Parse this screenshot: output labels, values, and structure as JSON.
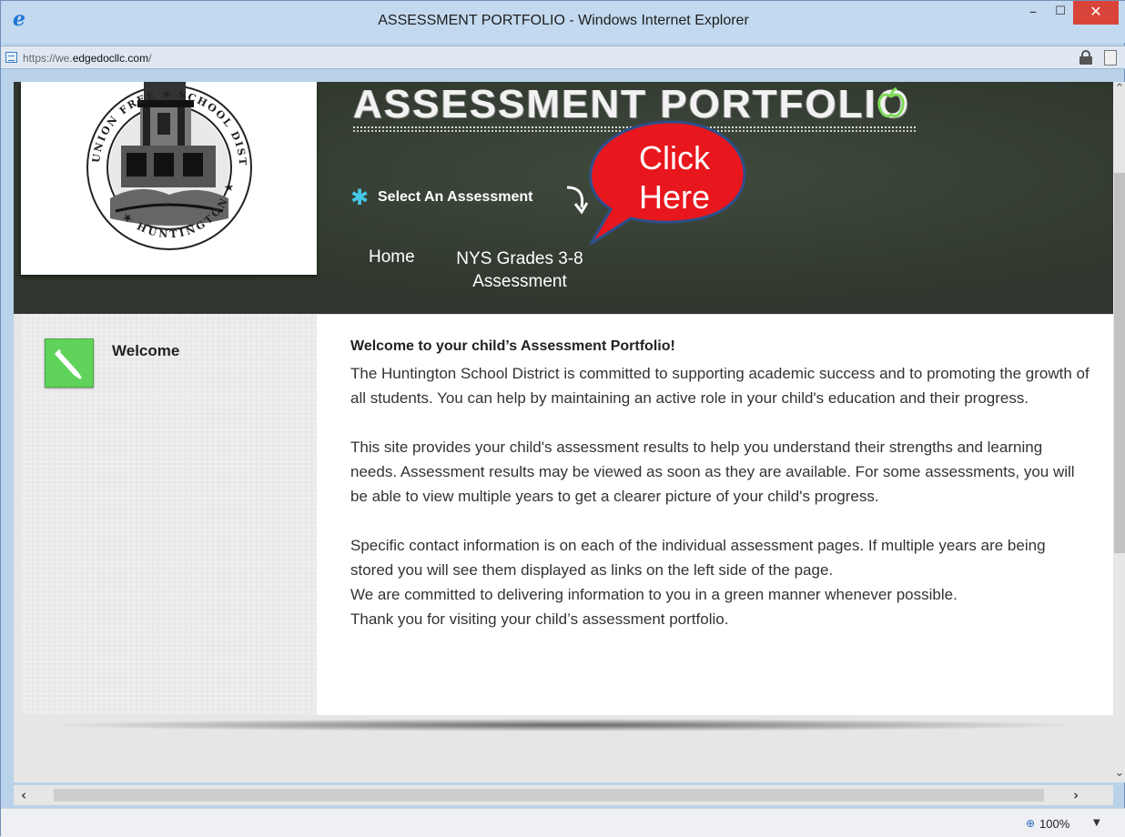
{
  "window": {
    "title": "ASSESSMENT PORTFOLIO - Windows Internet Explorer",
    "minimize_glyph": "–",
    "maximize_glyph": "☐",
    "close_glyph": "✕"
  },
  "address": {
    "url_prefix": "https://we.",
    "url_domain": "edgedocllc.com",
    "url_suffix": "/"
  },
  "header": {
    "title": "ASSESSMENT PORTFOLIO",
    "select_label": "Select An Assessment",
    "gear_glyph": "✱"
  },
  "nav": {
    "home": "Home",
    "nys_line1": "NYS Grades 3-8",
    "nys_line2": "Assessment"
  },
  "callout": {
    "line1": "Click",
    "line2": "Here",
    "fill": "#e8161d"
  },
  "sidebar": {
    "welcome": "Welcome"
  },
  "content": {
    "heading": "Welcome to your child’s Assessment Portfolio!",
    "p1": "The Huntington School District is committed to supporting academic success and to promoting the growth of all students. You can help by maintaining an active role in your child's education and their progress.",
    "p2": "This site provides your child's assessment results to help you understand their strengths and learning needs. Assessment results may be viewed as soon as they are available. For some assessments, you will be able to view multiple years to get a clearer picture of your child's progress.",
    "p3": "Specific contact information is on each of the individual assessment pages. If multiple years are being stored you will see them displayed as links on the left side of the page.",
    "p4": "We are committed to delivering information to you in a green manner whenever possible.",
    "p5": "Thank you for visiting your child’s assessment portfolio."
  },
  "status": {
    "zoom": "100%"
  }
}
